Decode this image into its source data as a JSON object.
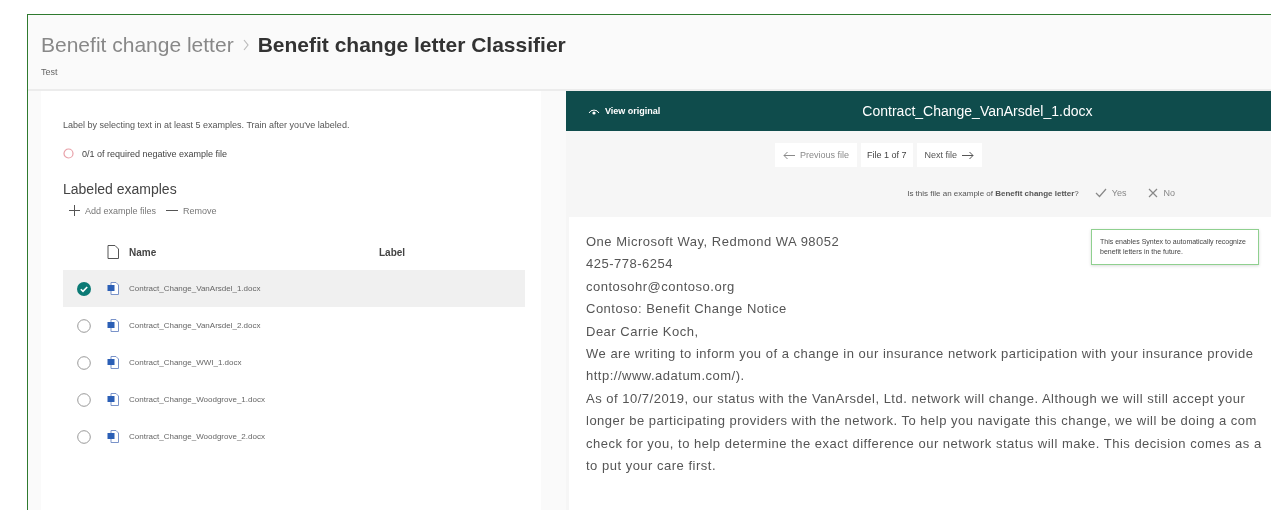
{
  "breadcrumb": {
    "parent": "Benefit change letter",
    "current": "Benefit change letter Classifier"
  },
  "subtitle": "Test",
  "left": {
    "instruction": "Label by selecting text in at least 5 examples. Train after you've labeled.",
    "requirement": "0/1 of required negative example file",
    "heading": "Labeled examples",
    "actions": [
      {
        "kind": "add",
        "label": "Add example files"
      },
      {
        "kind": "remove",
        "label": "Remove"
      }
    ],
    "table": {
      "columns": [
        "Name",
        "Label"
      ],
      "rows": [
        {
          "name": "Contract_Change_VanArsdel_1.docx",
          "selected": true
        },
        {
          "name": "Contract_Change_VanArsdel_2.docx",
          "selected": false
        },
        {
          "name": "Contract_Change_WWI_1.docx",
          "selected": false
        },
        {
          "name": "Contract_Change_Woodgrove_1.docx",
          "selected": false
        },
        {
          "name": "Contract_Change_Woodgrove_2.docx",
          "selected": false
        }
      ]
    }
  },
  "viewer": {
    "view_original": "View original",
    "file_name": "Contract_Change_VanArsdel_1.docx",
    "nav": {
      "previous": {
        "label": "Previous file",
        "disabled": true
      },
      "position": "File 1 of 7",
      "next": {
        "label": "Next file",
        "disabled": false
      }
    },
    "question": "Is this file an example of **Benefit change letter**?",
    "answers": [
      {
        "kind": "yes",
        "label": "Yes"
      },
      {
        "kind": "no",
        "label": "No"
      }
    ],
    "tooltip": "This enables Syntex to automatically recognize benefit letters in the future.",
    "lines": [
      "One Microsoft Way, Redmond WA 98052",
      "425-778-6254",
      "contosohr@contoso.org",
      "Contoso: Benefit Change Notice",
      "Dear Carrie Koch,",
      "We are writing to inform you of a change in our insurance network participation with your insurance provide",
      "http://www.adatum.com/).",
      "As of 10/7/2019, our status with the VanArsdel, Ltd. network will change. Although we will still accept your",
      "longer be participating providers with the network. To help you navigate this change, we will be doing a com",
      "check for you, to help determine the exact difference our network status will make. This decision comes as a",
      "to put your care first."
    ]
  }
}
